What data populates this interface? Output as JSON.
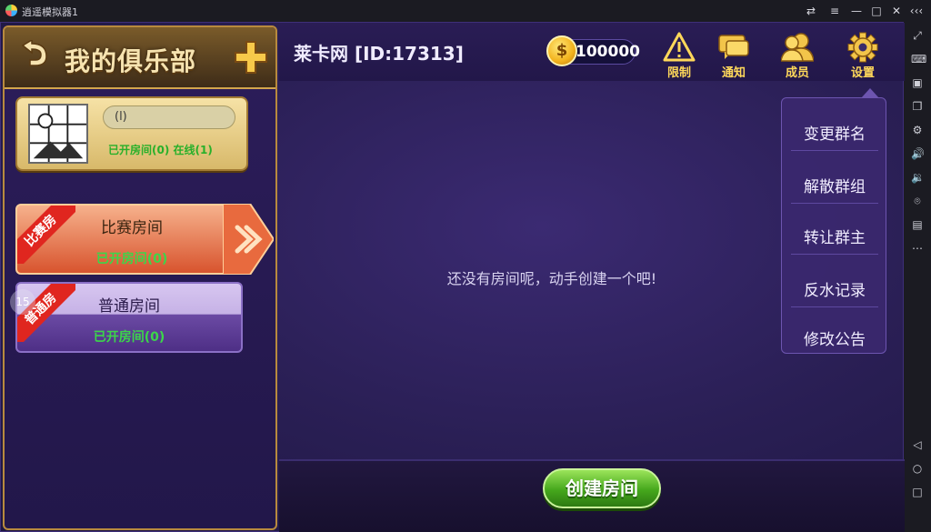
{
  "emulator": {
    "title": "逍遥模拟器1",
    "window_buttons": [
      "⇄",
      "≡",
      "—",
      "□",
      "✕",
      "‹‹‹"
    ],
    "side_icons": [
      "keyboard-icon",
      "screenshot-icon",
      "multi-window-icon",
      "settings-icon",
      "volume-up-icon",
      "volume-down-icon",
      "location-icon",
      "folder-icon",
      "more-icon",
      "back-icon",
      "home-icon",
      "recents-icon"
    ]
  },
  "left_panel": {
    "title": "我的俱乐部",
    "club": {
      "name": "(l)",
      "stats": "已开房间(0)  在线(1)"
    },
    "rooms": [
      {
        "tag": "比赛房",
        "name": "比赛房间",
        "open": "已开房间(0)"
      },
      {
        "tag": "普通房",
        "name": "普通房间",
        "open": "已开房间(0)"
      }
    ],
    "badge": "15"
  },
  "header": {
    "group_title": "莱卡网 [ID:17313]",
    "coins": "100000",
    "coin_symbol": "$",
    "buttons": [
      {
        "label": "限制",
        "icon": "warning-icon"
      },
      {
        "label": "通知",
        "icon": "chat-bubble-icon"
      },
      {
        "label": "成员",
        "icon": "members-icon"
      },
      {
        "label": "设置",
        "icon": "gear-icon"
      }
    ]
  },
  "content": {
    "empty_message": "还没有房间呢，动手创建一个吧!",
    "create_button": "创建房间"
  },
  "settings_menu": {
    "items": [
      "变更群名",
      "解散群组",
      "转让群主",
      "反水记录",
      "修改公告"
    ]
  }
}
